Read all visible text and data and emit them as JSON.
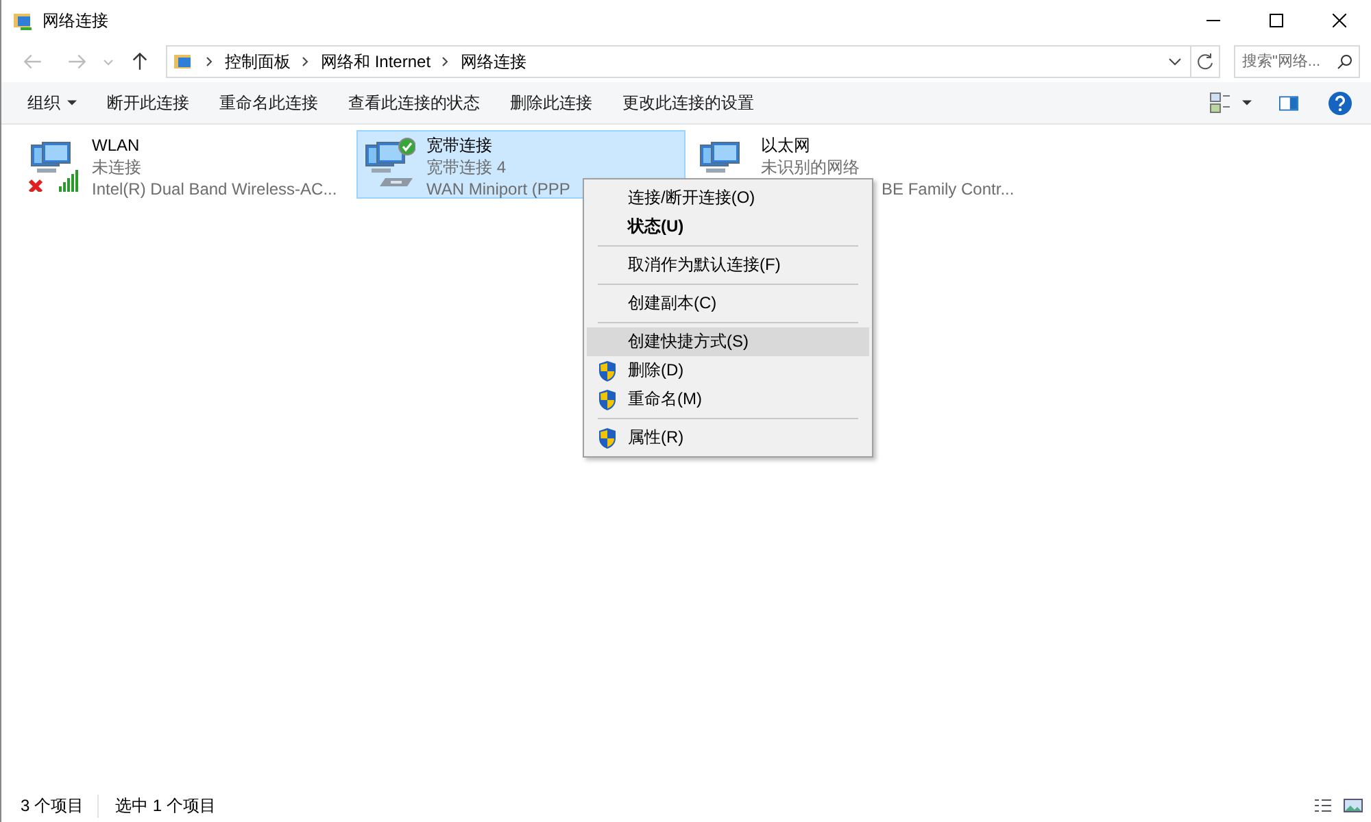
{
  "window": {
    "title": "网络连接"
  },
  "address": {
    "crumbs": [
      "控制面板",
      "网络和 Internet",
      "网络连接"
    ]
  },
  "search": {
    "placeholder": "搜索\"网络..."
  },
  "toolbar": [
    {
      "label": "组织",
      "dropdown": true
    },
    {
      "label": "断开此连接",
      "dropdown": false
    },
    {
      "label": "重命名此连接",
      "dropdown": false
    },
    {
      "label": "查看此连接的状态",
      "dropdown": false
    },
    {
      "label": "删除此连接",
      "dropdown": false
    },
    {
      "label": "更改此连接的设置",
      "dropdown": false
    }
  ],
  "connections": [
    {
      "kind": "wifi",
      "name": "WLAN",
      "status": "未连接",
      "device": "Intel(R) Dual Band Wireless-AC...",
      "selected": false
    },
    {
      "kind": "broadband",
      "name": "宽带连接",
      "status": "宽带连接 4",
      "device": "WAN Miniport (PPP",
      "selected": true
    },
    {
      "kind": "ethernet",
      "name": "以太网",
      "status": "未识别的网络",
      "device": "BE Family Contr...",
      "selected": false
    }
  ],
  "context_menu": [
    {
      "label": "连接/断开连接(O)",
      "bold": false,
      "shield": false,
      "highlighted": false,
      "divider_after": false
    },
    {
      "label": "状态(U)",
      "bold": true,
      "shield": false,
      "highlighted": false,
      "divider_after": true
    },
    {
      "label": "取消作为默认连接(F)",
      "bold": false,
      "shield": false,
      "highlighted": false,
      "divider_after": true
    },
    {
      "label": "创建副本(C)",
      "bold": false,
      "shield": false,
      "highlighted": false,
      "divider_after": true
    },
    {
      "label": "创建快捷方式(S)",
      "bold": false,
      "shield": false,
      "highlighted": true,
      "divider_after": false
    },
    {
      "label": "删除(D)",
      "bold": false,
      "shield": true,
      "highlighted": false,
      "divider_after": false
    },
    {
      "label": "重命名(M)",
      "bold": false,
      "shield": true,
      "highlighted": false,
      "divider_after": true
    },
    {
      "label": "属性(R)",
      "bold": false,
      "shield": true,
      "highlighted": false,
      "divider_after": false
    }
  ],
  "status_bar": [
    "3 个项目",
    "选中 1 个项目"
  ]
}
